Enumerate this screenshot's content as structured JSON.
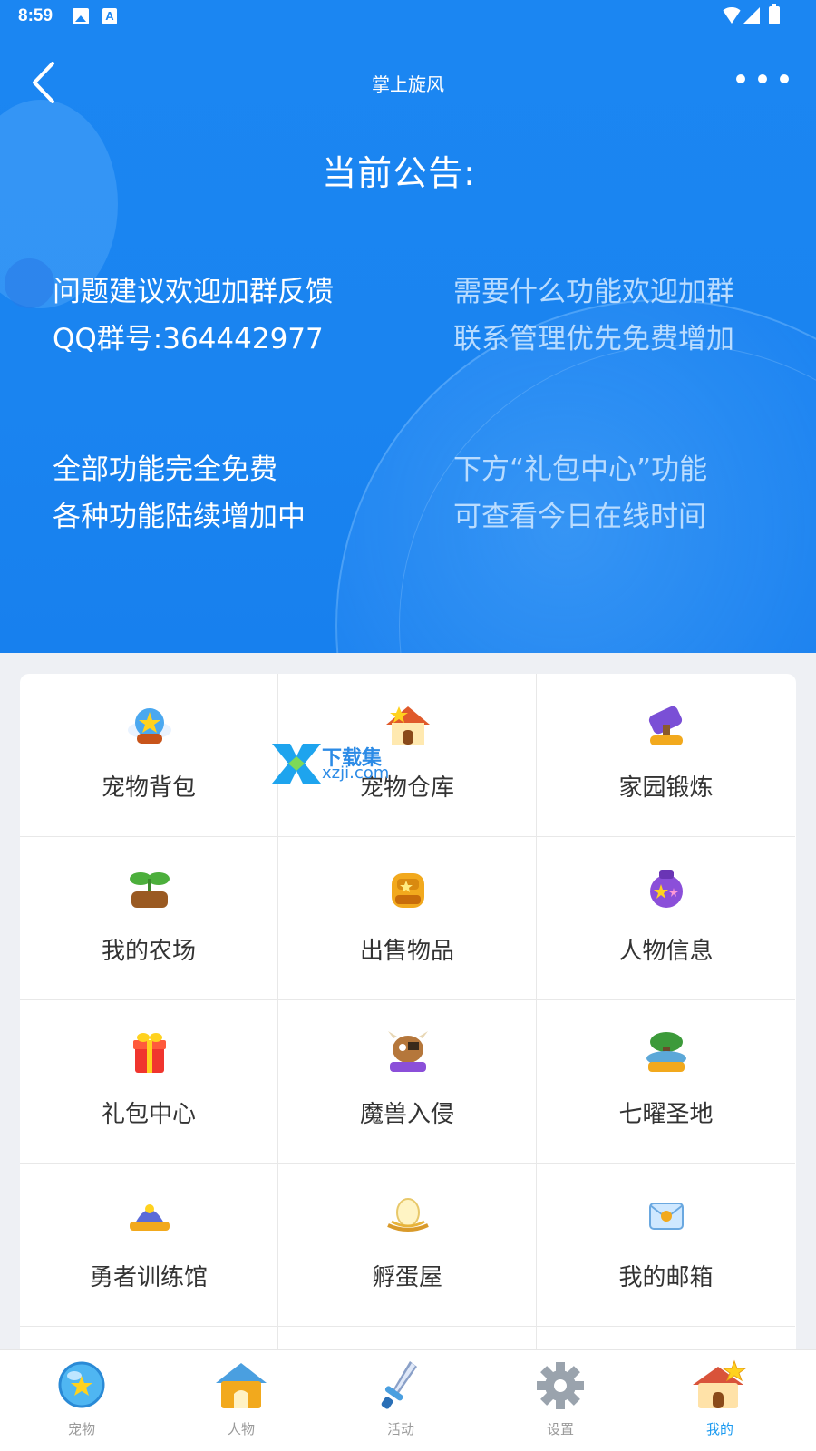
{
  "status_bar": {
    "time": "8:59",
    "a_icon_glyph": "A"
  },
  "header": {
    "title": "掌上旋风"
  },
  "notice": {
    "heading": "当前公告:",
    "blocks": [
      {
        "line1": "问题建议欢迎加群反馈",
        "line2": "QQ群号:364442977"
      },
      {
        "line1": "需要什么功能欢迎加群",
        "line2": "联系管理优先免费增加"
      },
      {
        "line1": "全部功能完全免费",
        "line2": "各种功能陆续增加中"
      },
      {
        "line1": "下方“礼包中心”功能",
        "line2": "可查看今日在线时间"
      }
    ]
  },
  "grid": {
    "items": [
      {
        "label": "宠物背包",
        "icon": "pet-bag-icon"
      },
      {
        "label": "宠物仓库",
        "icon": "pet-warehouse-icon"
      },
      {
        "label": "家园锻炼",
        "icon": "home-forging-icon"
      },
      {
        "label": "我的农场",
        "icon": "farm-icon"
      },
      {
        "label": "出售物品",
        "icon": "backpack-sell-icon"
      },
      {
        "label": "人物信息",
        "icon": "character-info-icon"
      },
      {
        "label": "礼包中心",
        "icon": "gift-box-icon"
      },
      {
        "label": "魔兽入侵",
        "icon": "monster-invasion-icon"
      },
      {
        "label": "七曜圣地",
        "icon": "holy-land-icon"
      },
      {
        "label": "勇者训练馆",
        "icon": "training-hall-icon"
      },
      {
        "label": "孵蛋屋",
        "icon": "egg-hatch-icon"
      },
      {
        "label": "我的邮箱",
        "icon": "mailbox-icon"
      }
    ]
  },
  "watermark": {
    "title": "下载集",
    "domain": "xzji.com"
  },
  "tabbar": {
    "tabs": [
      {
        "label": "宠物",
        "icon": "pet-orb-icon",
        "active": false
      },
      {
        "label": "人物",
        "icon": "house-icon",
        "active": false
      },
      {
        "label": "活动",
        "icon": "sword-icon",
        "active": false
      },
      {
        "label": "设置",
        "icon": "gear-icon",
        "active": false
      },
      {
        "label": "我的",
        "icon": "star-house-icon",
        "active": true
      }
    ]
  },
  "colors": {
    "header_blue": "#1b86f2",
    "active_tab": "#1b9af0"
  }
}
